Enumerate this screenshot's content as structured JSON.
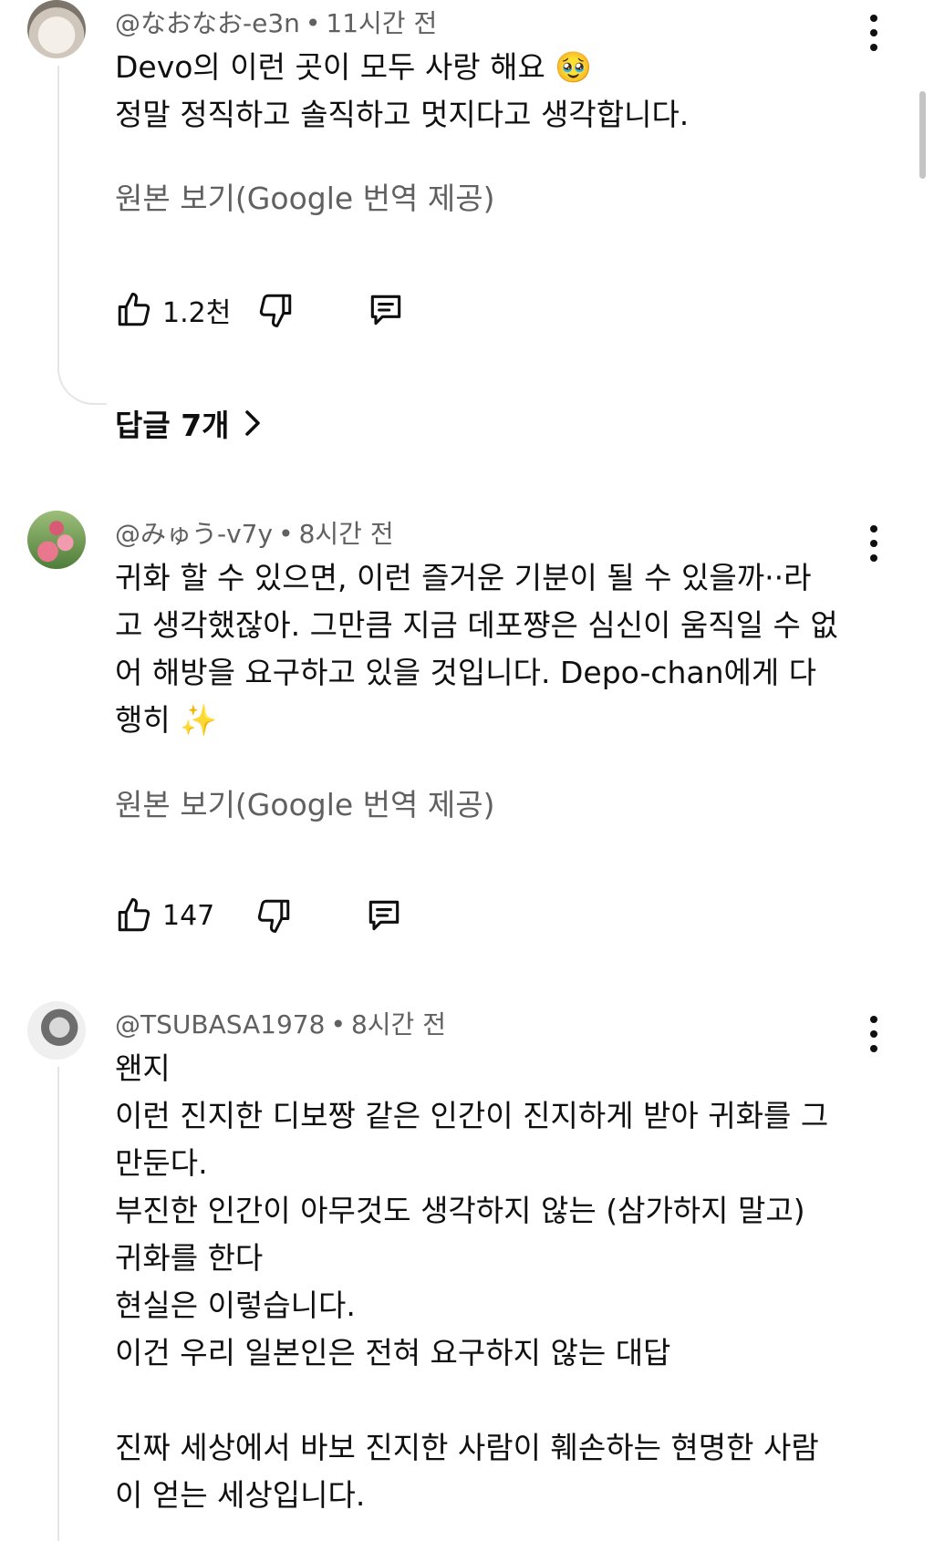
{
  "comments": [
    {
      "author": "@なおなお-e3n",
      "time": "11시간 전",
      "text": "Devo의 이런 곳이 모두 사랑 해요 🥹\n정말 정직하고 솔직하고 멋지다고 생각합니다.",
      "translate": "원본 보기(Google 번역 제공)",
      "likes": "1.2천",
      "replies": "답글 7개"
    },
    {
      "author": "@みゅう-v7y",
      "time": "8시간 전",
      "text": "귀화 할 수 있으면, 이런 즐거운 기분이 될 수 있을까··라\n고 생각했잖아. 그만큼 지금 데포쨩은 심신이 움직일 수 없\n어 해방을 요구하고 있을 것입니다. Depo-chan에게 다\n행히 ✨",
      "translate": "원본 보기(Google 번역 제공)",
      "likes": "147"
    },
    {
      "author": "@TSUBASA1978",
      "time": "8시간 전",
      "text": "왠지\n이런 진지한 디보짱 같은 인간이 진지하게 받아 귀화를 그\n만둔다.\n부진한 인간이 아무것도 생각하지 않는 (삼가하지 말고)\n귀화를 한다\n현실은 이렇습니다.\n이건 우리 일본인은 전혀 요구하지 않는 대답\n\n진짜 세상에서 바보 진지한 사람이 훼손하는 현명한 사람\n이 얻는 세상입니다."
    }
  ],
  "icons": {
    "like": "thumbs-up-icon",
    "dislike": "thumbs-down-icon",
    "reply": "comment-icon",
    "more": "more-vertical-icon",
    "chevron": "chevron-right-icon"
  },
  "colors": {
    "text": "#0f0f0f",
    "secondary": "#606060",
    "thread": "#e5e5e5"
  }
}
